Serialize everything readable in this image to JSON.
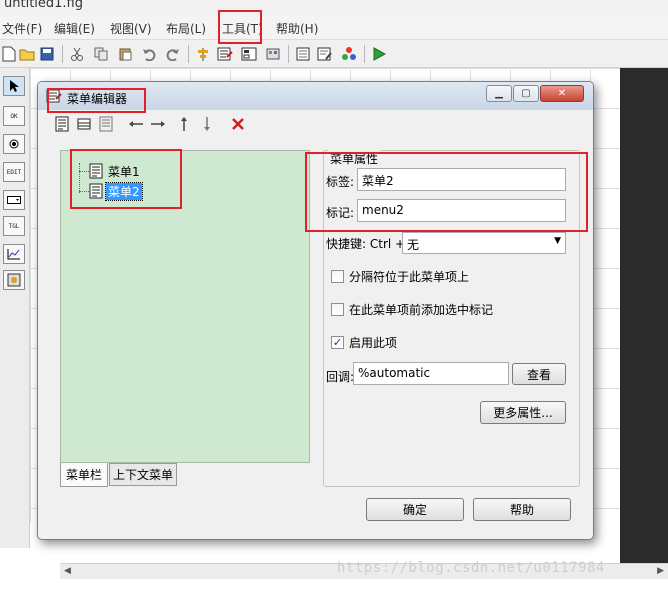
{
  "app": {
    "title": "untitled1.fig",
    "menu": [
      "文件(F)",
      "编辑(E)",
      "视图(V)",
      "布局(L)",
      "工具(T)",
      "帮助(H)"
    ]
  },
  "palette": [
    "",
    "OK",
    "",
    "",
    "EDIT",
    "",
    "",
    "TGL",
    "",
    ""
  ],
  "dialog": {
    "title": "菜单编辑器",
    "tree": [
      {
        "label": "菜单1",
        "selected": false
      },
      {
        "label": "菜单2",
        "selected": true
      }
    ],
    "tabs": [
      "菜单栏",
      "上下文菜单"
    ],
    "props": {
      "group_label": "菜单属性",
      "label_caption": "标签:",
      "label_value": "菜单2",
      "tag_caption": "标记:",
      "tag_value": "menu2",
      "shortcut_caption": "快捷键: Ctrl +",
      "shortcut_value": "无",
      "separator_check": "分隔符位于此菜单项上",
      "checkmark_check": "在此菜单项前添加选中标记",
      "enable_check": "启用此项",
      "callback_caption": "回调:",
      "callback_value": "%automatic",
      "view_button": "查看",
      "more_button": "更多属性..."
    },
    "ok_button": "确定",
    "help_button": "帮助",
    "checks": {
      "separator": false,
      "checkmark": false,
      "enable": true
    }
  },
  "watermark": "https://blog.csdn.net/u0117984"
}
